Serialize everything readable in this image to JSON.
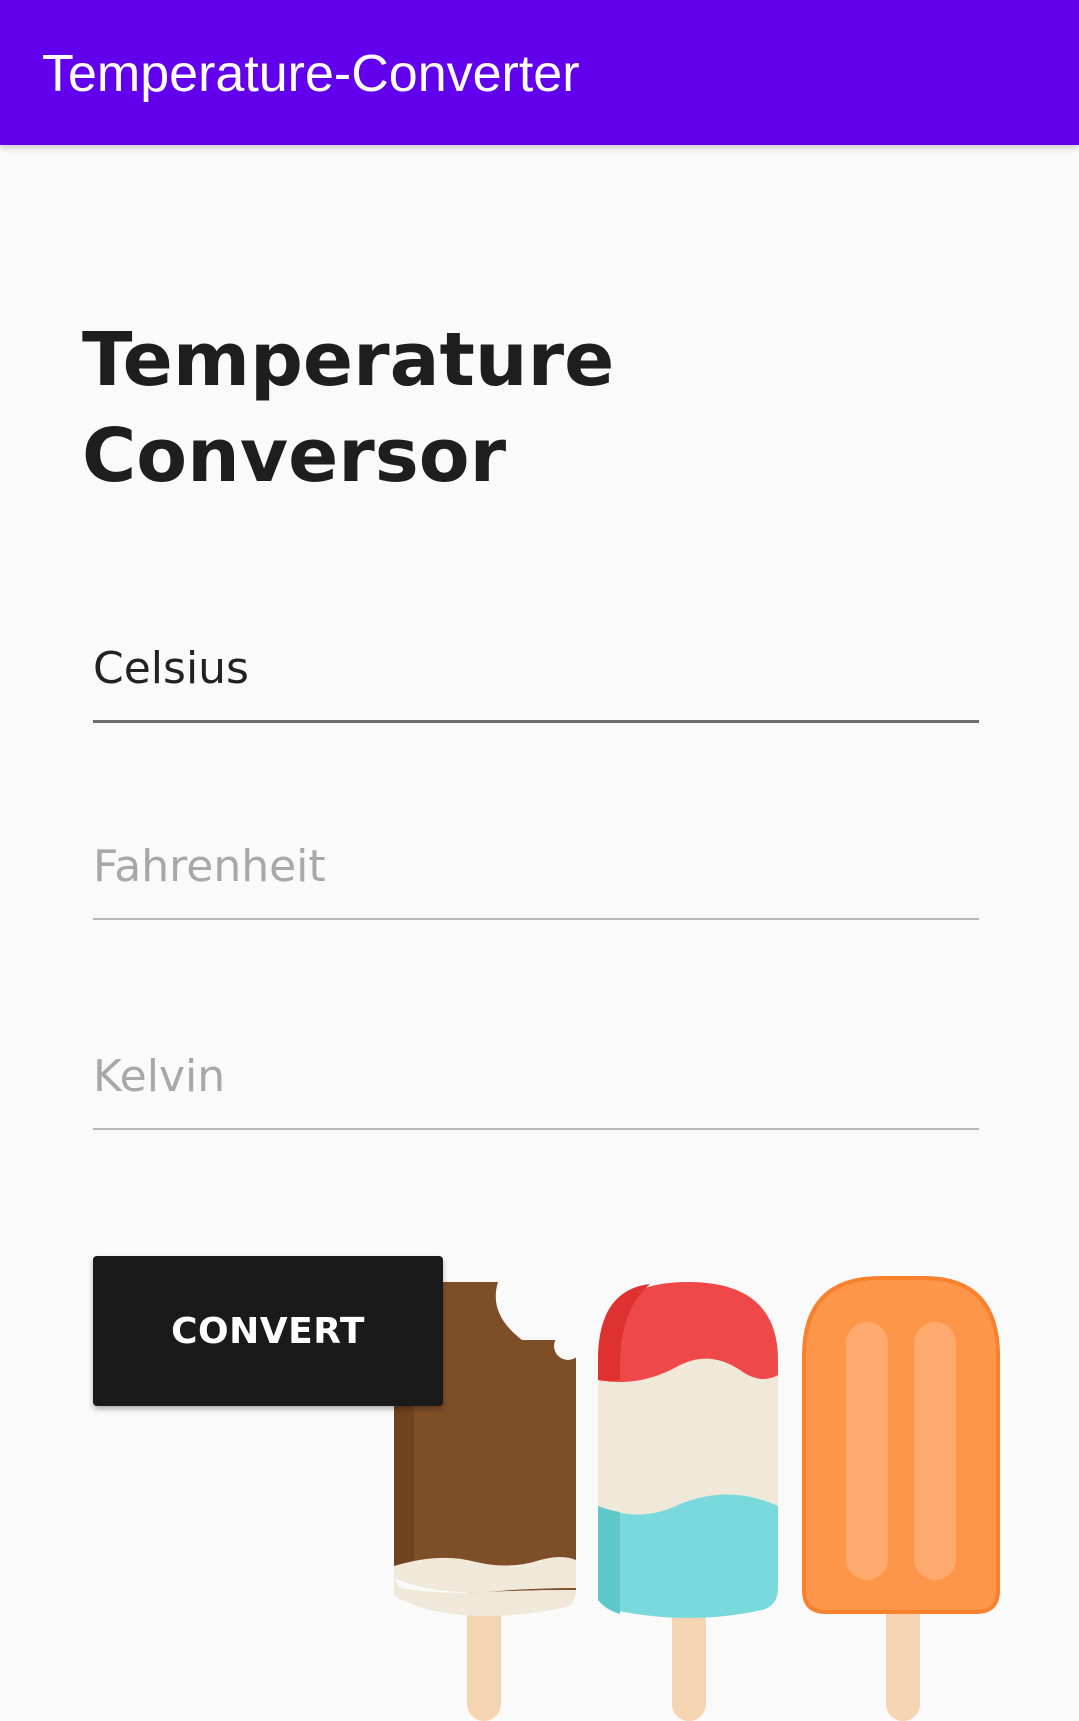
{
  "app_bar": {
    "title": "Temperature-Converter",
    "color": "#6200ee"
  },
  "heading": {
    "line1": "Temperature",
    "line2": "Conversor"
  },
  "fields": {
    "celsius": {
      "value": "Celsius",
      "placeholder": ""
    },
    "fahrenheit": {
      "value": "",
      "placeholder": "Fahrenheit"
    },
    "kelvin": {
      "value": "",
      "placeholder": "Kelvin"
    }
  },
  "convert_button": {
    "label": "CONVERT",
    "color": "#1a1a1a"
  },
  "illustration": {
    "name": "popsicles",
    "colors": {
      "chocolate": "#7e4e27",
      "red": "#ef4848",
      "cream": "#f0e9da",
      "cyan": "#7ad9dc",
      "orange": "#fd9649",
      "stick": "#f5d5b1"
    }
  }
}
